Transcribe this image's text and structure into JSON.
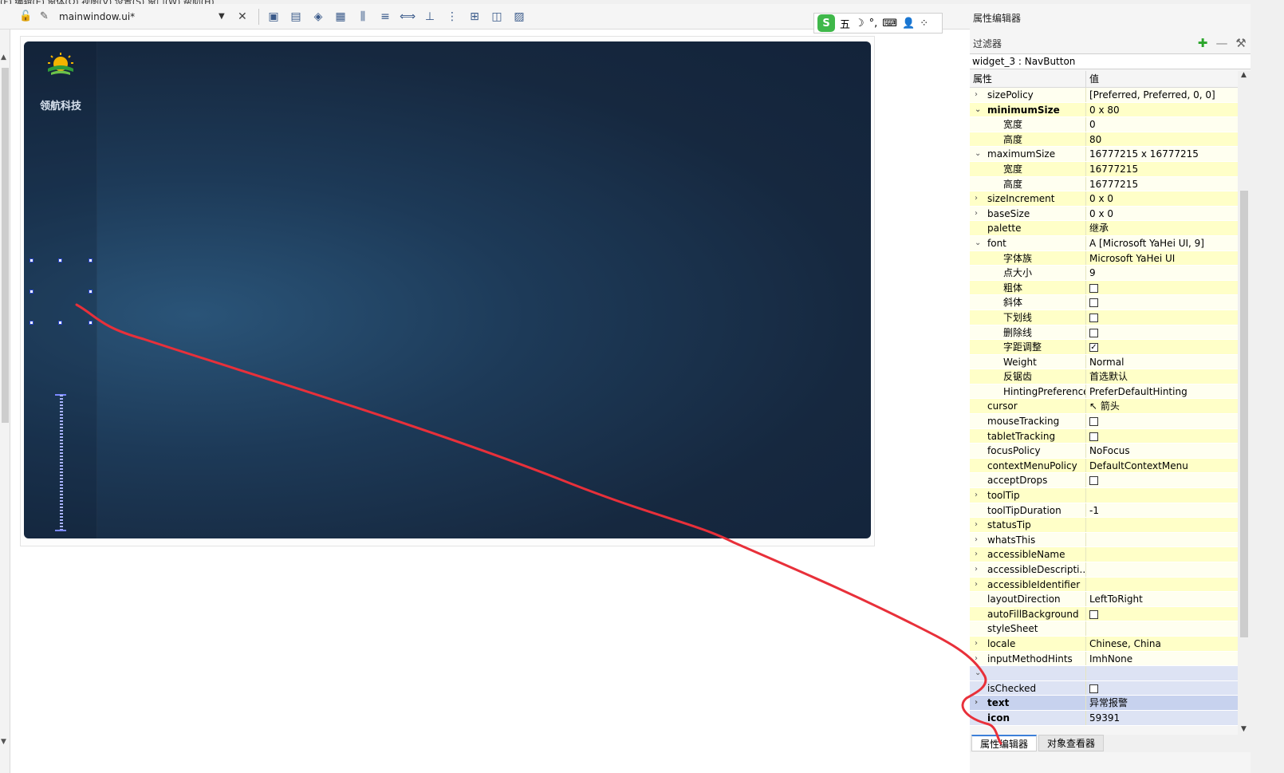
{
  "menu": {
    "strip_text": "(F)  编辑(E)  窗体(O)  视图(V)  设置(S)  窗口(W)  帮助(H)"
  },
  "file_toolbar": {
    "lock_icon": "lock-icon",
    "file_name": "mainwindow.ui*",
    "close_glyph": "✕",
    "tools": [
      "▣",
      "▤",
      "◈",
      "▦",
      "⫼",
      "≡",
      "⟺",
      "⊥",
      "⋮",
      "⊞",
      "◫",
      "▨"
    ]
  },
  "form": {
    "company_name": "领航科技",
    "nav_spacer": "vertical-spacer"
  },
  "ime": {
    "brand": "S",
    "mode": "五",
    "moon": "☽",
    "punct": "°,",
    "keyboard": "⌨",
    "user": "👤",
    "grid": "⁘"
  },
  "property_editor": {
    "title": "属性编辑器",
    "filter_label": "过滤器",
    "object_line": "widget_3 : NavButton",
    "col_property": "属性",
    "col_value": "值",
    "rows": [
      {
        "name": "sizePolicy",
        "value": "[Preferred, Preferred, 0, 0]",
        "arrow": "›",
        "style": "y",
        "indent": 0
      },
      {
        "name": "minimumSize",
        "value": "0 x 80",
        "arrow": "⌄",
        "style": "y2",
        "indent": 0,
        "bold": true
      },
      {
        "name": "宽度",
        "value": "0",
        "arrow": "",
        "style": "y",
        "indent": 1
      },
      {
        "name": "高度",
        "value": "80",
        "arrow": "",
        "style": "y2",
        "indent": 1
      },
      {
        "name": "maximumSize",
        "value": "16777215 x 16777215",
        "arrow": "⌄",
        "style": "y",
        "indent": 0
      },
      {
        "name": "宽度",
        "value": "16777215",
        "arrow": "",
        "style": "y2",
        "indent": 1
      },
      {
        "name": "高度",
        "value": "16777215",
        "arrow": "",
        "style": "y",
        "indent": 1
      },
      {
        "name": "sizeIncrement",
        "value": "0 x 0",
        "arrow": "›",
        "style": "y2",
        "indent": 0
      },
      {
        "name": "baseSize",
        "value": "0 x 0",
        "arrow": "›",
        "style": "y",
        "indent": 0
      },
      {
        "name": "palette",
        "value": "继承",
        "arrow": "",
        "style": "y2",
        "indent": 0
      },
      {
        "name": "font",
        "value": "A  [Microsoft YaHei UI, 9]",
        "arrow": "⌄",
        "style": "y",
        "indent": 0
      },
      {
        "name": "字体族",
        "value": "Microsoft YaHei UI",
        "arrow": "",
        "style": "y2",
        "indent": 1
      },
      {
        "name": "点大小",
        "value": "9",
        "arrow": "",
        "style": "y",
        "indent": 1
      },
      {
        "name": "粗体",
        "value": "",
        "check": "off",
        "arrow": "",
        "style": "y2",
        "indent": 1
      },
      {
        "name": "斜体",
        "value": "",
        "check": "off",
        "arrow": "",
        "style": "y",
        "indent": 1
      },
      {
        "name": "下划线",
        "value": "",
        "check": "off",
        "arrow": "",
        "style": "y2",
        "indent": 1
      },
      {
        "name": "删除线",
        "value": "",
        "check": "off",
        "arrow": "",
        "style": "y",
        "indent": 1
      },
      {
        "name": "字距调整",
        "value": "",
        "check": "on",
        "arrow": "",
        "style": "y2",
        "indent": 1
      },
      {
        "name": "Weight",
        "value": "Normal",
        "arrow": "",
        "style": "y",
        "indent": 1
      },
      {
        "name": "反锯齿",
        "value": "首选默认",
        "arrow": "",
        "style": "y2",
        "indent": 1
      },
      {
        "name": "HintingPreference",
        "value": "PreferDefaultHinting",
        "arrow": "",
        "style": "y",
        "indent": 1
      },
      {
        "name": "cursor",
        "value": "↖  箭头",
        "arrow": "",
        "style": "y2",
        "indent": 0
      },
      {
        "name": "mouseTracking",
        "value": "",
        "check": "off",
        "arrow": "",
        "style": "y",
        "indent": 0
      },
      {
        "name": "tabletTracking",
        "value": "",
        "check": "off",
        "arrow": "",
        "style": "y2",
        "indent": 0
      },
      {
        "name": "focusPolicy",
        "value": "NoFocus",
        "arrow": "",
        "style": "y",
        "indent": 0
      },
      {
        "name": "contextMenuPolicy",
        "value": "DefaultContextMenu",
        "arrow": "",
        "style": "y2",
        "indent": 0
      },
      {
        "name": "acceptDrops",
        "value": "",
        "check": "off",
        "arrow": "",
        "style": "y",
        "indent": 0
      },
      {
        "name": "toolTip",
        "value": "",
        "arrow": "›",
        "style": "y2",
        "indent": 0
      },
      {
        "name": "toolTipDuration",
        "value": "-1",
        "arrow": "",
        "style": "y",
        "indent": 0
      },
      {
        "name": "statusTip",
        "value": "",
        "arrow": "›",
        "style": "y2",
        "indent": 0
      },
      {
        "name": "whatsThis",
        "value": "",
        "arrow": "›",
        "style": "y",
        "indent": 0
      },
      {
        "name": "accessibleName",
        "value": "",
        "arrow": "›",
        "style": "y2",
        "indent": 0
      },
      {
        "name": "accessibleDescripti...",
        "value": "",
        "arrow": "›",
        "style": "y",
        "indent": 0
      },
      {
        "name": "accessibleIdentifier",
        "value": "",
        "arrow": "›",
        "style": "y2",
        "indent": 0
      },
      {
        "name": "layoutDirection",
        "value": "LeftToRight",
        "arrow": "",
        "style": "y",
        "indent": 0
      },
      {
        "name": "autoFillBackground",
        "value": "",
        "check": "off",
        "arrow": "",
        "style": "y2",
        "indent": 0
      },
      {
        "name": "styleSheet",
        "value": "",
        "arrow": "",
        "style": "y",
        "indent": 0
      },
      {
        "name": "locale",
        "value": "Chinese, China",
        "arrow": "›",
        "style": "y2",
        "indent": 0
      },
      {
        "name": "inputMethodHints",
        "value": "ImhNone",
        "arrow": "›",
        "style": "y",
        "indent": 0
      },
      {
        "name": "",
        "value": "",
        "arrow": "⌄",
        "style": "b",
        "indent": 0
      },
      {
        "name": "isChecked",
        "value": "",
        "check": "off",
        "arrow": "",
        "style": "b",
        "indent": 0
      },
      {
        "name": "text",
        "value": "异常报警",
        "arrow": "›",
        "style": "bsel",
        "indent": 0,
        "bold": true
      },
      {
        "name": "icon",
        "value": "59391",
        "arrow": "",
        "style": "b",
        "indent": 0,
        "bold": true
      }
    ],
    "tabs": [
      "属性编辑器",
      "对象查看器"
    ]
  }
}
